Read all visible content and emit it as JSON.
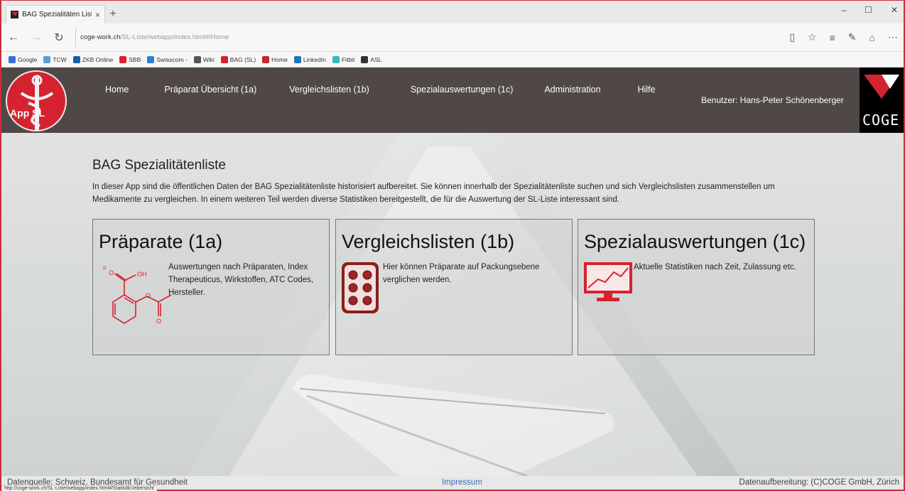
{
  "browser": {
    "tab_title": "BAG Spezialitäten Liste",
    "tab_close": "×",
    "new_tab": "+",
    "window_controls": [
      "–",
      "☐",
      "✕"
    ],
    "url_host": "coge-work.ch",
    "url_path": "/SL-Liste/webapp/index.html#/Home",
    "favorites": [
      {
        "label": "Google",
        "color": "#3b6fd8"
      },
      {
        "label": "TCW",
        "color": "#5aa0d8"
      },
      {
        "label": "ZKB Online",
        "color": "#1b5fa8"
      },
      {
        "label": "SBB",
        "color": "#e0202a"
      },
      {
        "label": "Swisscom -",
        "color": "#2f7fd0"
      },
      {
        "label": "Wiki",
        "color": "#555555"
      },
      {
        "label": "BAG (SL)",
        "color": "#d82030"
      },
      {
        "label": "Home",
        "color": "#c0282e"
      },
      {
        "label": "LinkedIn",
        "color": "#1d76b5"
      },
      {
        "label": "Fitbit",
        "color": "#39b9b4"
      },
      {
        "label": "ASL",
        "color": "#333333"
      }
    ],
    "status_url": "http://coge-work.ch/SL-Liste/webapp/index.html#/StatistikUebersicht"
  },
  "header": {
    "logo_text": "App SL",
    "nav": [
      "Home",
      "Präparat Übersicht (1a)",
      "Vergleichslisten (1b)",
      "Spezialauswertungen (1c)",
      "Administration",
      "Hilfe"
    ],
    "user": "Benutzer: Hans-Peter Schönenberger",
    "brand": "COGE"
  },
  "main": {
    "title": "BAG Spezialitätenliste",
    "intro": "In dieser App sind die öffentlichen Daten der BAG Spezialitätenliste historisiert aufbereitet. Sie können innerhalb der Spezialitätenliste suchen und sich Vergleichslisten zusammenstellen um Medikamente zu vergleichen. In einem weiteren Teil werden diverse Statistiken bereitgestellt, die für die Auswertung der SL-Liste interessant sind.",
    "cards": [
      {
        "title": "Präparate (1a)",
        "text": "Auswertungen nach Präparaten, Index Therapeuticus, Wirkstoffen, ATC Codes, Hersteller.",
        "icon": "molecule-icon"
      },
      {
        "title": "Vergleichslisten (1b)",
        "text": "Hier können Präparate auf Packungsebene verglichen werden.",
        "icon": "pill-blister-icon"
      },
      {
        "title": "Spezialauswertungen (1c)",
        "text": "Aktuelle Statistiken nach Zeit, Zulassung etc.",
        "icon": "chart-monitor-icon"
      }
    ]
  },
  "footer": {
    "source": "Datenquelle: Schweiz. Bundesamt für Gesundheit",
    "impressum": "Impressum",
    "credit": "Datenaufbereitung: (C)COGE GmbH, Zürich"
  },
  "colors": {
    "accent": "#d5222f",
    "header_bg": "#504747",
    "link": "#3a6fb0"
  }
}
